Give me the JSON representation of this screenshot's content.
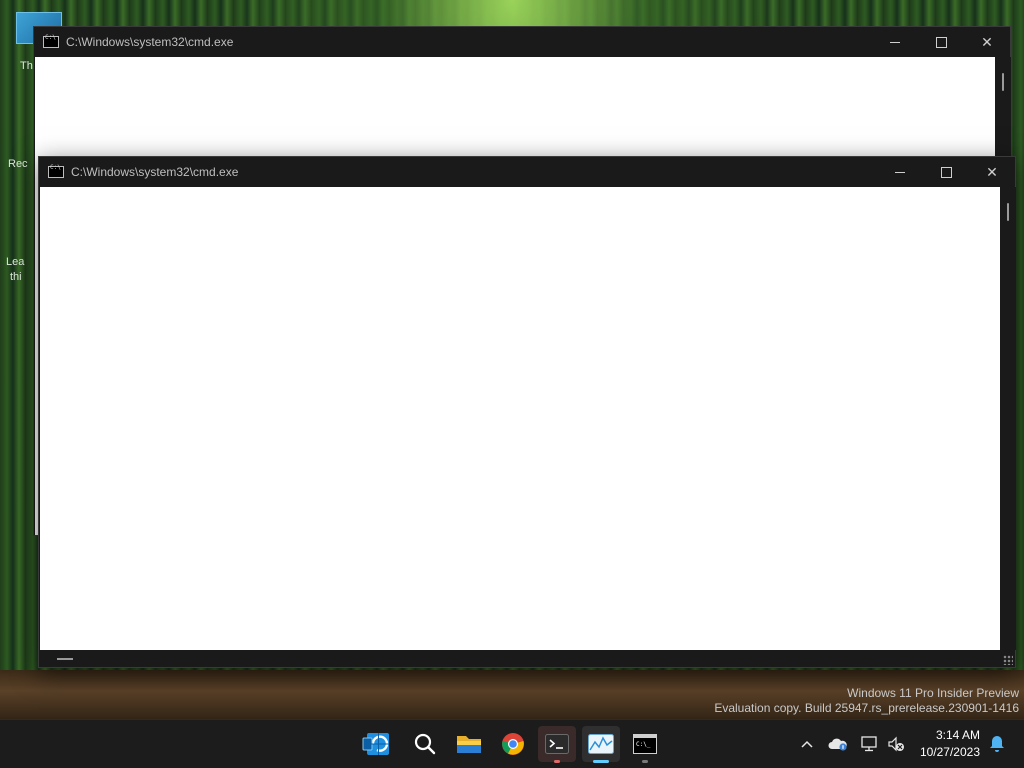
{
  "desktop": {
    "left_fragments": [
      "Th",
      "Rec",
      "Lea",
      "thi"
    ]
  },
  "window_back": {
    "title": "C:\\Windows\\system32\\cmd.exe"
  },
  "window_front": {
    "title": "C:\\Windows\\system32\\cmd.exe"
  },
  "watermark": {
    "line1": "Windows 11 Pro Insider Preview",
    "line2": "Evaluation copy. Build 25947.rs_prerelease.230901-1416"
  },
  "taskbar": {
    "apps": [
      "start-icon",
      "search-icon",
      "file-explorer-icon",
      "chrome-icon",
      "terminal-icon",
      "task-manager-icon",
      "cmd-icon"
    ],
    "clock": {
      "time": "3:14 AM",
      "date": "10/27/2023"
    }
  }
}
